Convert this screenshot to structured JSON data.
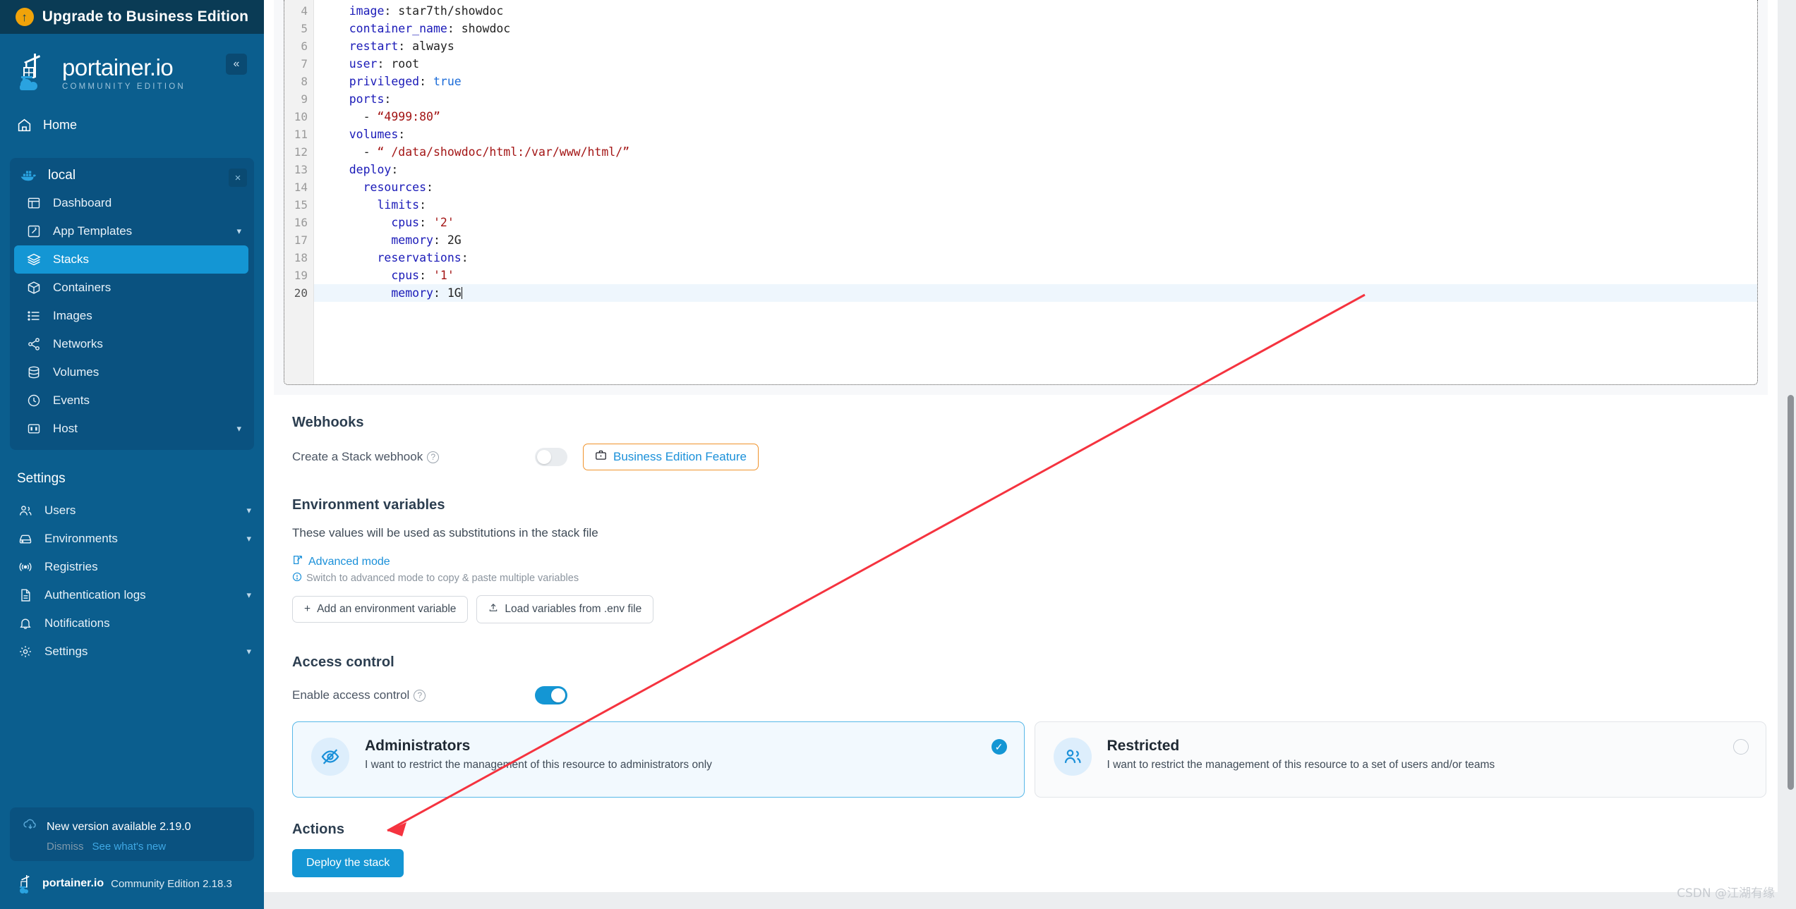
{
  "sidebar": {
    "upgrade_banner": {
      "label": "Upgrade to Business Edition",
      "icon": "arrow-up-circle-icon"
    },
    "brand": {
      "title": "portainer.io",
      "subtitle": "COMMUNITY EDITION"
    },
    "collapse_label": "«",
    "home": {
      "label": "Home",
      "icon": "home-icon"
    },
    "environment": {
      "name": "local",
      "icon": "docker-icon",
      "close_label": "×"
    },
    "env_items": [
      {
        "label": "Dashboard",
        "icon": "dashboard-icon",
        "chevron": "",
        "active": false
      },
      {
        "label": "App Templates",
        "icon": "edit-square-icon",
        "chevron": "⌄",
        "active": false
      },
      {
        "label": "Stacks",
        "icon": "layers-icon",
        "chevron": "",
        "active": true
      },
      {
        "label": "Containers",
        "icon": "cube-icon",
        "chevron": "",
        "active": false
      },
      {
        "label": "Images",
        "icon": "list-icon",
        "chevron": "",
        "active": false
      },
      {
        "label": "Networks",
        "icon": "share-nodes-icon",
        "chevron": "",
        "active": false
      },
      {
        "label": "Volumes",
        "icon": "database-icon",
        "chevron": "",
        "active": false
      },
      {
        "label": "Events",
        "icon": "clock-icon",
        "chevron": "",
        "active": false
      },
      {
        "label": "Host",
        "icon": "server-icon",
        "chevron": "⌄",
        "active": false
      }
    ],
    "settings_title": "Settings",
    "settings_items": [
      {
        "label": "Users",
        "icon": "users-icon",
        "chevron": "⌄"
      },
      {
        "label": "Environments",
        "icon": "hard-drive-icon",
        "chevron": "⌄"
      },
      {
        "label": "Registries",
        "icon": "radio-signal-icon",
        "chevron": ""
      },
      {
        "label": "Authentication logs",
        "icon": "file-text-icon",
        "chevron": "⌄"
      },
      {
        "label": "Notifications",
        "icon": "bell-icon",
        "chevron": ""
      },
      {
        "label": "Settings",
        "icon": "gear-icon",
        "chevron": "⌄"
      }
    ],
    "version_notice": {
      "text": "New version available 2.19.0",
      "dismiss": "Dismiss",
      "whats_new": "See what's new",
      "icon": "cloud-download-icon"
    },
    "footer": {
      "brand": "portainer.io",
      "edition": "Community Edition 2.18.3",
      "icon": "portainer-logo-icon"
    }
  },
  "editor": {
    "lines": [
      {
        "num": "4",
        "indent": 4,
        "key": "image",
        "sep": ": ",
        "value": "star7th/showdoc",
        "vtype": "v",
        "active": false
      },
      {
        "num": "5",
        "indent": 4,
        "key": "container_name",
        "sep": ": ",
        "value": "showdoc",
        "vtype": "v",
        "active": false
      },
      {
        "num": "6",
        "indent": 4,
        "key": "restart",
        "sep": ": ",
        "value": "always",
        "vtype": "v",
        "active": false
      },
      {
        "num": "7",
        "indent": 4,
        "key": "user",
        "sep": ": ",
        "value": "root",
        "vtype": "v",
        "active": false
      },
      {
        "num": "8",
        "indent": 4,
        "key": "privileged",
        "sep": ": ",
        "value": "true",
        "vtype": "b",
        "active": false
      },
      {
        "num": "9",
        "indent": 4,
        "key": "ports",
        "sep": ":",
        "value": "",
        "vtype": "v",
        "active": false
      },
      {
        "num": "10",
        "indent": 6,
        "key": "",
        "sep": "- ",
        "value": "“4999:80”",
        "vtype": "s",
        "active": false
      },
      {
        "num": "11",
        "indent": 4,
        "key": "volumes",
        "sep": ":",
        "value": "",
        "vtype": "v",
        "active": false
      },
      {
        "num": "12",
        "indent": 6,
        "key": "",
        "sep": "- ",
        "value": "“ /data/showdoc/html:/var/www/html/”",
        "vtype": "s",
        "active": false
      },
      {
        "num": "13",
        "indent": 4,
        "key": "deploy",
        "sep": ":",
        "value": "",
        "vtype": "v",
        "active": false
      },
      {
        "num": "14",
        "indent": 6,
        "key": "resources",
        "sep": ":",
        "value": "",
        "vtype": "v",
        "active": false
      },
      {
        "num": "15",
        "indent": 8,
        "key": "limits",
        "sep": ":",
        "value": "",
        "vtype": "v",
        "active": false
      },
      {
        "num": "16",
        "indent": 10,
        "key": "cpus",
        "sep": ": ",
        "value": "'2'",
        "vtype": "s",
        "active": false
      },
      {
        "num": "17",
        "indent": 10,
        "key": "memory",
        "sep": ": ",
        "value": "2G",
        "vtype": "v",
        "active": false
      },
      {
        "num": "18",
        "indent": 8,
        "key": "reservations",
        "sep": ":",
        "value": "",
        "vtype": "v",
        "active": false
      },
      {
        "num": "19",
        "indent": 10,
        "key": "cpus",
        "sep": ": ",
        "value": "'1'",
        "vtype": "s",
        "active": false
      },
      {
        "num": "20",
        "indent": 10,
        "key": "memory",
        "sep": ": ",
        "value": "1G",
        "vtype": "v",
        "active": true
      }
    ]
  },
  "webhooks": {
    "title": "Webhooks",
    "field_label": "Create a Stack webhook",
    "help_icon": "question-circle-icon",
    "toggle_on": false,
    "badge_label": "Business Edition Feature",
    "badge_icon": "briefcase-icon"
  },
  "env_vars": {
    "title": "Environment variables",
    "description": "These values will be used as substitutions in the stack file",
    "advanced_link": "Advanced mode",
    "advanced_icon": "edit-square-icon",
    "hint": "Switch to advanced mode to copy & paste multiple variables",
    "hint_icon": "info-circle-icon",
    "add_button": "Add an environment variable",
    "add_icon": "plus-icon",
    "load_button": "Load variables from .env file",
    "load_icon": "upload-icon"
  },
  "access_control": {
    "title": "Access control",
    "field_label": "Enable access control",
    "help_icon": "question-circle-icon",
    "toggle_on": true,
    "options": [
      {
        "name": "Administrators",
        "desc": "I want to restrict the management of this resource to administrators only",
        "icon": "eye-off-icon",
        "selected": true
      },
      {
        "name": "Restricted",
        "desc": "I want to restrict the management of this resource to a set of users and/or teams",
        "icon": "users-icon",
        "selected": false
      }
    ]
  },
  "actions": {
    "title": "Actions",
    "deploy_button": "Deploy the stack"
  },
  "watermark": "CSDN @江湖有缘",
  "colors": {
    "sidebar_bg": "#0b5e8e",
    "sidebar_banner": "#0a3b55",
    "accent": "#1496d4",
    "badge_border": "#f0932b",
    "annotation": "#f5333f"
  }
}
